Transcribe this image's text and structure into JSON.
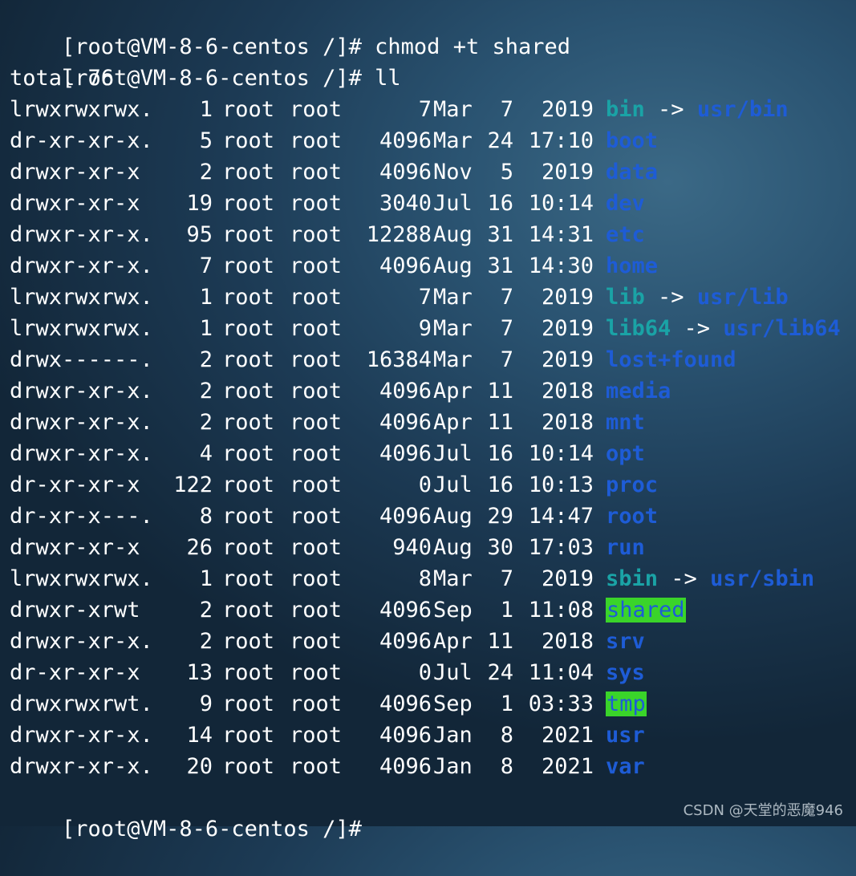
{
  "terminal": {
    "commands": [
      {
        "prompt": "[root@VM-8-6-centos /]#",
        "command": " chmod +t shared"
      },
      {
        "prompt": "[root@VM-8-6-centos /]#",
        "command": " ll"
      }
    ],
    "total_line": "total 76",
    "entries": [
      {
        "perms": "lrwxrwxrwx.",
        "links": "1",
        "owner": "root",
        "group": "root",
        "size": "7",
        "month": "Mar",
        "day": "7",
        "time": "2019",
        "name": "bin",
        "arrow": "->",
        "target": "usr/bin",
        "kind": "link"
      },
      {
        "perms": "dr-xr-xr-x.",
        "links": "5",
        "owner": "root",
        "group": "root",
        "size": "4096",
        "month": "Mar",
        "day": "24",
        "time": "17:10",
        "name": "boot",
        "kind": "dir"
      },
      {
        "perms": "drwxr-xr-x",
        "links": "2",
        "owner": "root",
        "group": "root",
        "size": "4096",
        "month": "Nov",
        "day": "5",
        "time": "2019",
        "name": "data",
        "kind": "dir"
      },
      {
        "perms": "drwxr-xr-x",
        "links": "19",
        "owner": "root",
        "group": "root",
        "size": "3040",
        "month": "Jul",
        "day": "16",
        "time": "10:14",
        "name": "dev",
        "kind": "dir"
      },
      {
        "perms": "drwxr-xr-x.",
        "links": "95",
        "owner": "root",
        "group": "root",
        "size": "12288",
        "month": "Aug",
        "day": "31",
        "time": "14:31",
        "name": "etc",
        "kind": "dir"
      },
      {
        "perms": "drwxr-xr-x.",
        "links": "7",
        "owner": "root",
        "group": "root",
        "size": "4096",
        "month": "Aug",
        "day": "31",
        "time": "14:30",
        "name": "home",
        "kind": "dir"
      },
      {
        "perms": "lrwxrwxrwx.",
        "links": "1",
        "owner": "root",
        "group": "root",
        "size": "7",
        "month": "Mar",
        "day": "7",
        "time": "2019",
        "name": "lib",
        "arrow": "->",
        "target": "usr/lib",
        "kind": "link"
      },
      {
        "perms": "lrwxrwxrwx.",
        "links": "1",
        "owner": "root",
        "group": "root",
        "size": "9",
        "month": "Mar",
        "day": "7",
        "time": "2019",
        "name": "lib64",
        "arrow": "->",
        "target": "usr/lib64",
        "kind": "link"
      },
      {
        "perms": "drwx------.",
        "links": "2",
        "owner": "root",
        "group": "root",
        "size": "16384",
        "month": "Mar",
        "day": "7",
        "time": "2019",
        "name": "lost+found",
        "kind": "dir"
      },
      {
        "perms": "drwxr-xr-x.",
        "links": "2",
        "owner": "root",
        "group": "root",
        "size": "4096",
        "month": "Apr",
        "day": "11",
        "time": "2018",
        "name": "media",
        "kind": "dir"
      },
      {
        "perms": "drwxr-xr-x.",
        "links": "2",
        "owner": "root",
        "group": "root",
        "size": "4096",
        "month": "Apr",
        "day": "11",
        "time": "2018",
        "name": "mnt",
        "kind": "dir"
      },
      {
        "perms": "drwxr-xr-x.",
        "links": "4",
        "owner": "root",
        "group": "root",
        "size": "4096",
        "month": "Jul",
        "day": "16",
        "time": "10:14",
        "name": "opt",
        "kind": "dir"
      },
      {
        "perms": "dr-xr-xr-x",
        "links": "122",
        "owner": "root",
        "group": "root",
        "size": "0",
        "month": "Jul",
        "day": "16",
        "time": "10:13",
        "name": "proc",
        "kind": "dir"
      },
      {
        "perms": "dr-xr-x---.",
        "links": "8",
        "owner": "root",
        "group": "root",
        "size": "4096",
        "month": "Aug",
        "day": "29",
        "time": "14:47",
        "name": "root",
        "kind": "dir"
      },
      {
        "perms": "drwxr-xr-x",
        "links": "26",
        "owner": "root",
        "group": "root",
        "size": "940",
        "month": "Aug",
        "day": "30",
        "time": "17:03",
        "name": "run",
        "kind": "dir"
      },
      {
        "perms": "lrwxrwxrwx.",
        "links": "1",
        "owner": "root",
        "group": "root",
        "size": "8",
        "month": "Mar",
        "day": "7",
        "time": "2019",
        "name": "sbin",
        "arrow": "->",
        "target": "usr/sbin",
        "kind": "link"
      },
      {
        "perms": "drwxr-xrwt",
        "links": "2",
        "owner": "root",
        "group": "root",
        "size": "4096",
        "month": "Sep",
        "day": "1",
        "time": "11:08",
        "name": "shared",
        "kind": "sticky"
      },
      {
        "perms": "drwxr-xr-x.",
        "links": "2",
        "owner": "root",
        "group": "root",
        "size": "4096",
        "month": "Apr",
        "day": "11",
        "time": "2018",
        "name": "srv",
        "kind": "dir"
      },
      {
        "perms": "dr-xr-xr-x",
        "links": "13",
        "owner": "root",
        "group": "root",
        "size": "0",
        "month": "Jul",
        "day": "24",
        "time": "11:04",
        "name": "sys",
        "kind": "dir"
      },
      {
        "perms": "drwxrwxrwt.",
        "links": "9",
        "owner": "root",
        "group": "root",
        "size": "4096",
        "month": "Sep",
        "day": "1",
        "time": "03:33",
        "name": "tmp",
        "kind": "sticky"
      },
      {
        "perms": "drwxr-xr-x.",
        "links": "14",
        "owner": "root",
        "group": "root",
        "size": "4096",
        "month": "Jan",
        "day": "8",
        "time": "2021",
        "name": "usr",
        "kind": "dir"
      },
      {
        "perms": "drwxr-xr-x.",
        "links": "20",
        "owner": "root",
        "group": "root",
        "size": "4096",
        "month": "Jan",
        "day": "8",
        "time": "2021",
        "name": "var",
        "kind": "dir"
      }
    ],
    "final_prompt": "[root@VM-8-6-centos /]#",
    "colors": {
      "directory": "#1e5cd6",
      "symlink": "#1aa3a6",
      "sticky_background": "#3ad42a",
      "text": "#ffffff"
    }
  },
  "watermark": "CSDN @天堂的恶魔946"
}
